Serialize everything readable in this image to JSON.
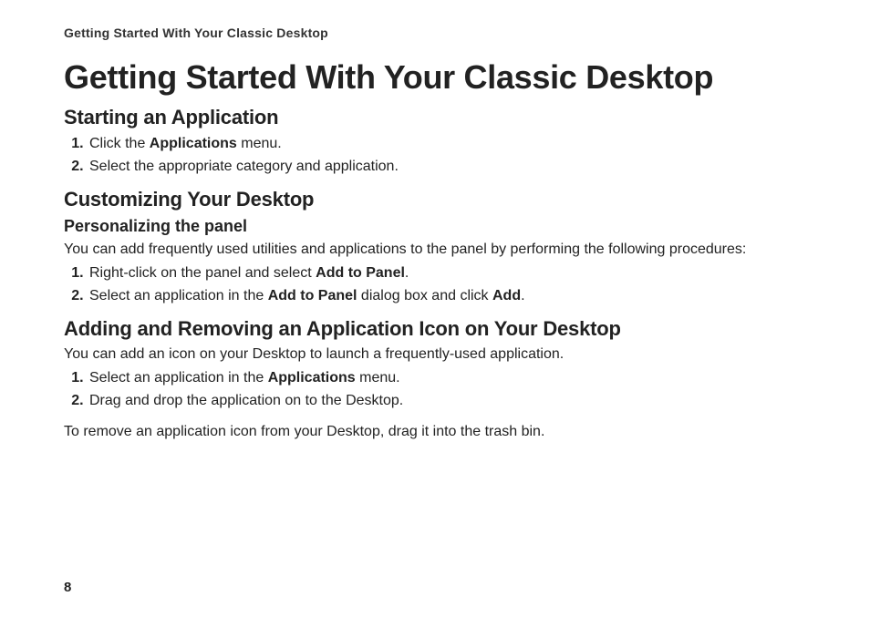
{
  "runningHeader": "Getting Started With Your Classic Desktop",
  "title": "Getting Started With Your Classic Desktop",
  "section1": {
    "heading": "Starting an Application",
    "step1_pre": "Click the ",
    "step1_bold": "Applications",
    "step1_post": " menu.",
    "step2": "Select the appropriate category and application."
  },
  "section2": {
    "heading": "Customizing Your Desktop",
    "sub1_heading": "Personalizing the panel",
    "sub1_intro": "You can add frequently used utilities and applications to the panel by performing the following procedures:",
    "sub1_step1_pre": "Right-click on the panel and select ",
    "sub1_step1_bold": "Add to Panel",
    "sub1_step1_post": ".",
    "sub1_step2_pre": "Select an application in the ",
    "sub1_step2_bold1": "Add to Panel",
    "sub1_step2_mid": " dialog box and click ",
    "sub1_step2_bold2": "Add",
    "sub1_step2_post": "."
  },
  "section3": {
    "heading": "Adding and Removing an Application Icon on Your Desktop",
    "intro": "You can add an icon on your Desktop to launch a frequently-used application.",
    "step1_pre": "Select an application in the ",
    "step1_bold": "Applications",
    "step1_post": " menu.",
    "step2": "Drag and drop the application on to the Desktop.",
    "outro": "To remove an application icon from your Desktop, drag it into the trash bin."
  },
  "pageNumber": "8"
}
